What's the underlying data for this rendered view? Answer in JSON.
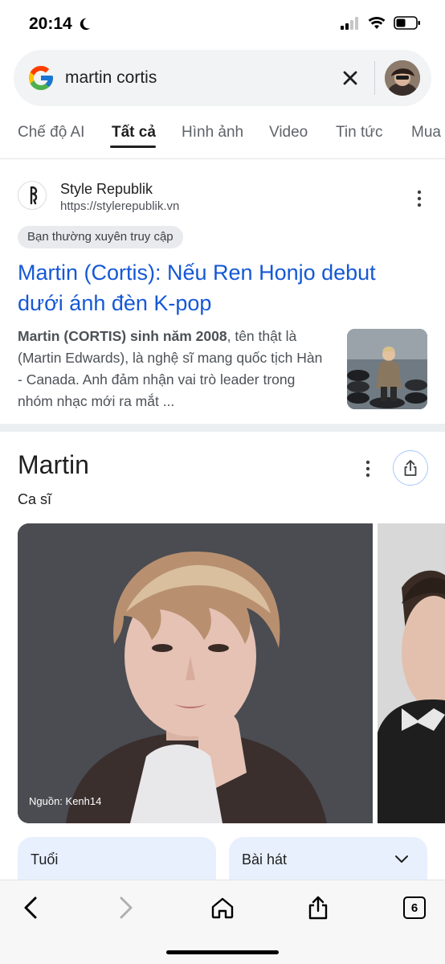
{
  "status": {
    "time": "20:14"
  },
  "search": {
    "query": "martin cortis"
  },
  "tabs": [
    {
      "label": "Chế độ AI"
    },
    {
      "label": "Tất cả"
    },
    {
      "label": "Hình ảnh"
    },
    {
      "label": "Video"
    },
    {
      "label": "Tin tức"
    },
    {
      "label": "Mua"
    }
  ],
  "result": {
    "site_name": "Style Republik",
    "site_url": "https://stylerepublik.vn",
    "chip": "Bạn thường xuyên truy cập",
    "title": "Martin (Cortis): Nếu Ren Honjo debut dưới ánh đèn K-pop",
    "snippet_bold": "Martin (CORTIS) sinh năm 2008",
    "snippet_rest": ", tên thật là (Martin Edwards), là nghệ sĩ mang quốc tịch Hàn - Canada. Anh đảm nhận vai trò leader trong nhóm nhạc mới ra mắt ..."
  },
  "knowledge_panel": {
    "title": "Martin",
    "subtitle": "Ca sĩ",
    "photo_credit": "Nguồn: Kenh14",
    "chips": [
      {
        "label": "Tuổi"
      },
      {
        "label": "Bài hát"
      }
    ]
  },
  "bottom_bar": {
    "tab_count": "6"
  },
  "colors": {
    "link": "#1558d6",
    "chip_bg": "#e8f0fe"
  }
}
